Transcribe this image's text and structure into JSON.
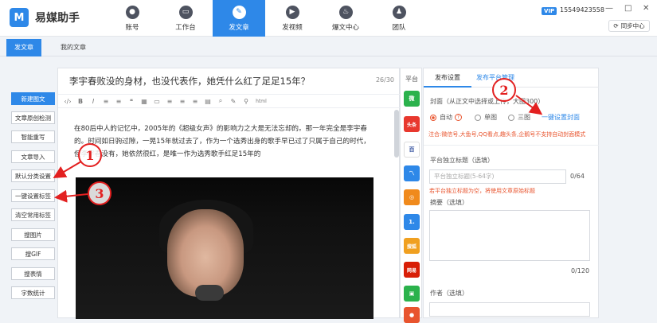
{
  "app": {
    "logo_mark": "M",
    "title": "易媒助手"
  },
  "nav": [
    {
      "label": "账号",
      "icon": "user-icon",
      "glyph": "●"
    },
    {
      "label": "工作台",
      "icon": "monitor-icon",
      "glyph": "▭"
    },
    {
      "label": "发文章",
      "icon": "pen-icon",
      "glyph": "✎"
    },
    {
      "label": "发视频",
      "icon": "video-icon",
      "glyph": "▶"
    },
    {
      "label": "爆文中心",
      "icon": "fire-icon",
      "glyph": "♨"
    },
    {
      "label": "团队",
      "icon": "team-icon",
      "glyph": "♟"
    }
  ],
  "account": {
    "vip": "VIP",
    "phone": "15549423558"
  },
  "window": {
    "minimize": "—",
    "restore": "□",
    "close": "✕"
  },
  "sync": "同步中心",
  "tabs": [
    "发文章",
    "我的文章"
  ],
  "left_buttons": [
    "新建图文",
    "文章原创检测",
    "智能重写",
    "文章导入",
    "默认分类设置",
    "一键设置标签",
    "清空常用标签",
    "搜图片",
    "搜GIF",
    "搜表情",
    "字数统计"
  ],
  "editor": {
    "title": "李宇春败没的身材，也没代表作，她凭什么红了足足15年？",
    "title_count": "26/30",
    "toolbar": [
      "‹/›",
      "B",
      "I",
      "≡",
      "≡",
      "❝",
      "▦",
      "▭",
      "≡",
      "≡",
      "≡",
      "▤",
      "⌕",
      "✎",
      "⚲",
      "html"
    ],
    "paragraph": "在80后中人的记忆中，2005年的《超级女声》的影响力之大是无法忘却的。那一年完全是李宇春的。时间如日驹过隙，一晃15年就过去了，作为一个选秀出身的歌手早已过了只属于自己的时代，但李宇春没有，她依然很红，是唯一作为选秀歌手红足15年的"
  },
  "platform": {
    "label": "平台",
    "items": [
      {
        "name": "wechat-icon",
        "text": "微",
        "color": "#2bb24c"
      },
      {
        "name": "toutiao-icon",
        "text": "头条",
        "color": "#e8382e"
      },
      {
        "name": "baijia-icon",
        "text": "百",
        "color": "#ffffff"
      },
      {
        "name": "dayu-icon",
        "text": "〽",
        "color": "#2e88e8"
      },
      {
        "name": "sohu-icon",
        "text": "◎",
        "color": "#f08a1c"
      },
      {
        "name": "yidian-icon",
        "text": "1.",
        "color": "#2e88e8"
      },
      {
        "name": "souhu-icon",
        "text": "搜狐",
        "color": "#f0a020"
      },
      {
        "name": "netease-icon",
        "text": "网易",
        "color": "#d81e06"
      },
      {
        "name": "qq-icon",
        "text": "▣",
        "color": "#2bb24c"
      },
      {
        "name": "bottom-icon",
        "text": "●",
        "color": "#e8542e"
      }
    ]
  },
  "settings": {
    "tab_publish": "发布设置",
    "tab_platform": "发布平台管理",
    "cover_label": "封面（从正文中选择或上传，大图300）",
    "radio_auto": "自动",
    "radio_single": "单图",
    "radio_triple": "三图",
    "oneclick_cover": "一键设置封面",
    "cover_hint": "注合:微信号,大鱼号,QQ看点,趣头条,企鹅号不支持自动封面模式",
    "independent_title_label": "平台独立标题（选填）",
    "independent_title_placeholder": "平台独立标题(5-64字)",
    "independent_title_count": "0/64",
    "independent_title_error": "若平台独立标题为空，将使用文章原始标题",
    "summary_label": "摘要（选填）",
    "summary_count": "0/120",
    "author_label": "作者（选填）"
  },
  "annotations": [
    "1",
    "2",
    "3"
  ]
}
